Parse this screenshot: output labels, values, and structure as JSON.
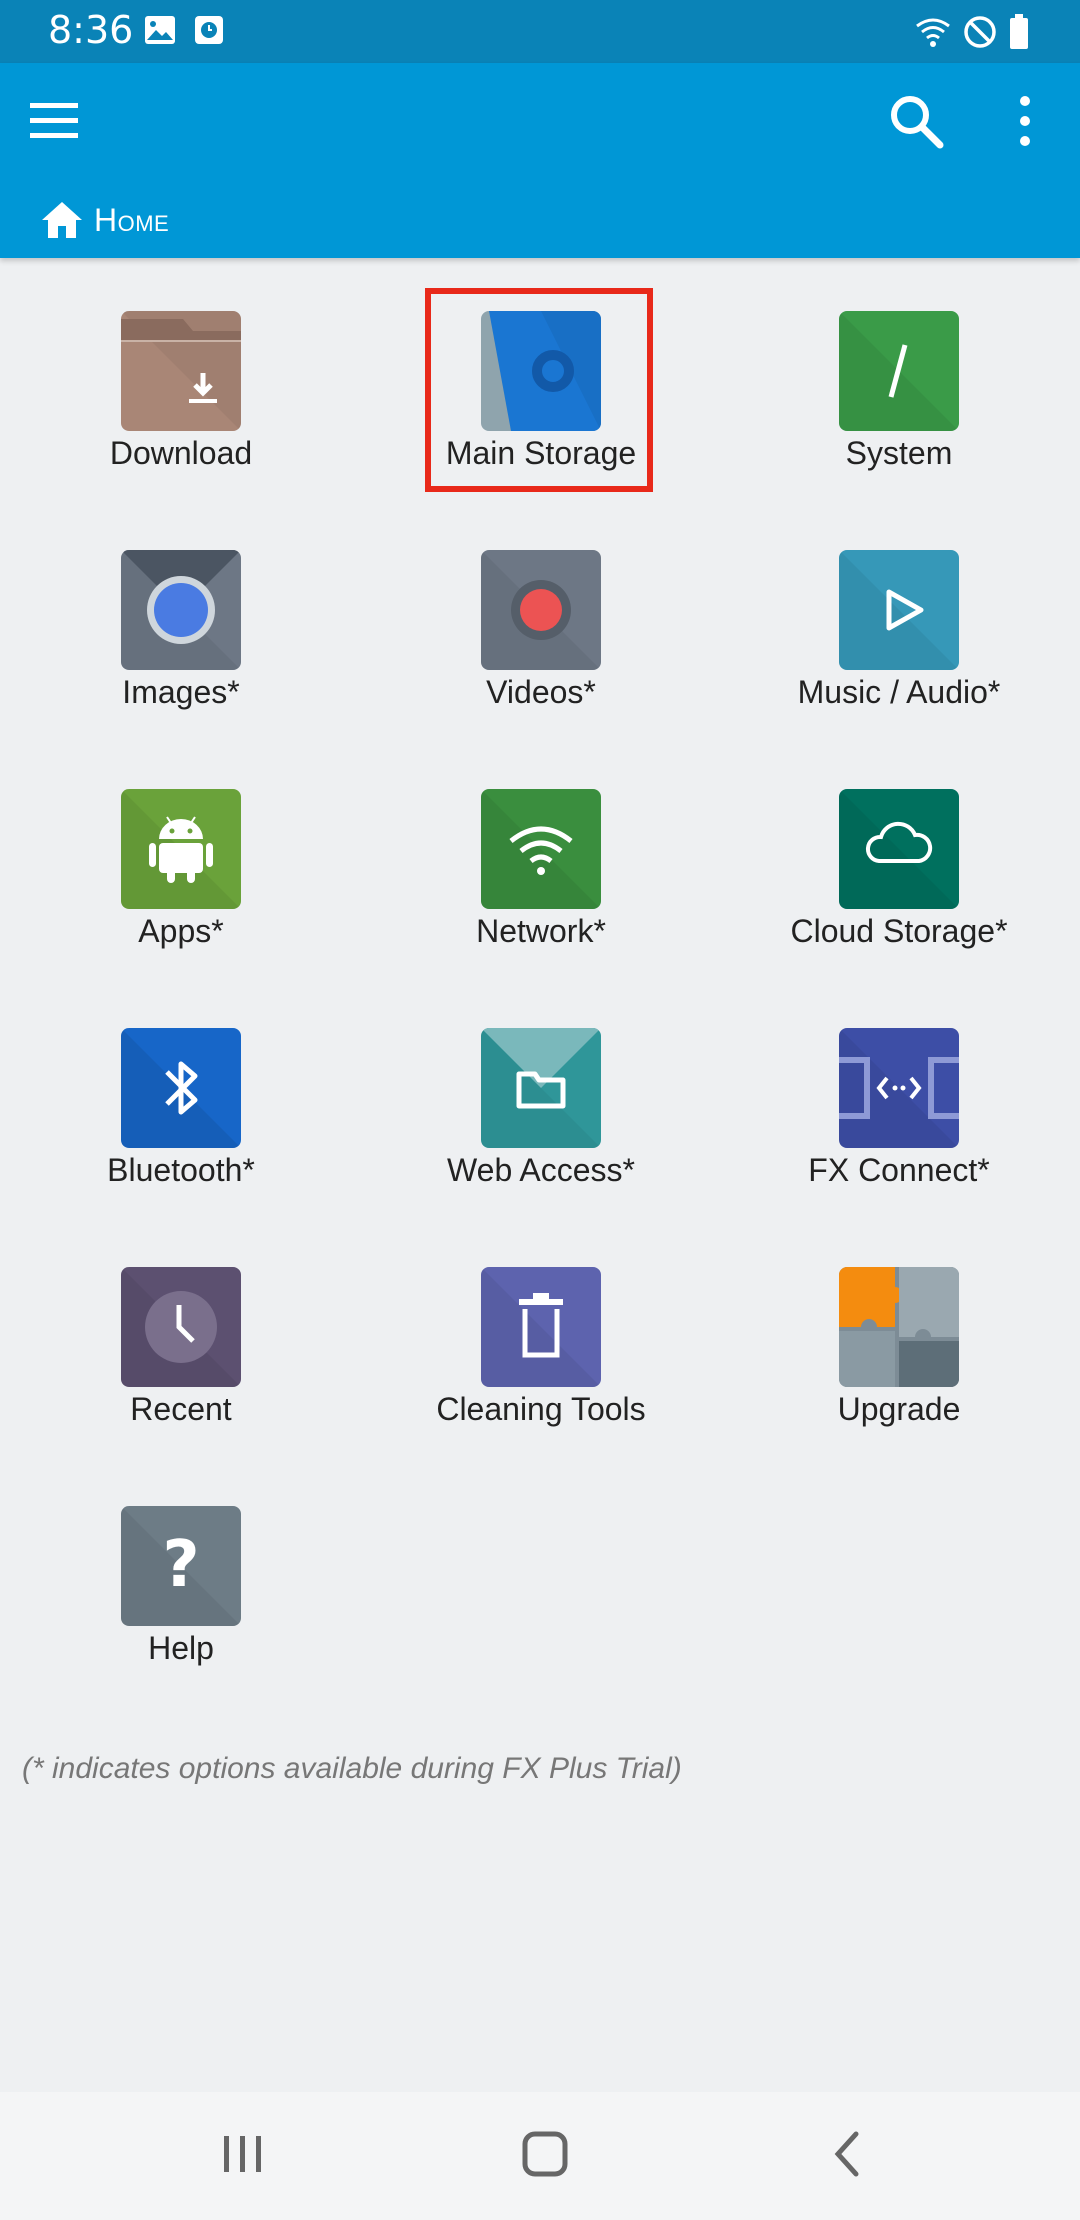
{
  "status_bar": {
    "time": "8:36",
    "left_icons": [
      "image-icon",
      "clock-app-icon"
    ],
    "right_icons": [
      "wifi-icon",
      "do-not-disturb-icon",
      "battery-icon"
    ]
  },
  "app_bar": {
    "menu_icon": "menu-icon",
    "search_icon": "search-icon",
    "more_icon": "more-vert-icon",
    "breadcrumb": {
      "icon": "home-icon",
      "label": "Home"
    }
  },
  "grid": {
    "items": [
      {
        "label": "Download",
        "icon": "download-folder-icon",
        "color": "#a98676"
      },
      {
        "label": "Main Storage",
        "icon": "main-storage-icon",
        "color": "#1a76d2"
      },
      {
        "label": "System",
        "icon": "system-icon",
        "color": "#3a9b48"
      },
      {
        "label": "Images*",
        "icon": "images-icon",
        "color": "#5f6f7e"
      },
      {
        "label": "Videos*",
        "icon": "videos-icon",
        "color": "#6d7785"
      },
      {
        "label": "Music / Audio*",
        "icon": "music-play-icon",
        "color": "#2f93b4"
      },
      {
        "label": "Apps*",
        "icon": "android-icon",
        "color": "#6aa23a"
      },
      {
        "label": "Network*",
        "icon": "wifi-network-icon",
        "color": "#3a8e3e"
      },
      {
        "label": "Cloud Storage*",
        "icon": "cloud-icon",
        "color": "#00705e"
      },
      {
        "label": "Bluetooth*",
        "icon": "bluetooth-icon",
        "color": "#1766c8"
      },
      {
        "label": "Web Access*",
        "icon": "folder-icon",
        "color": "#2f9699"
      },
      {
        "label": "FX Connect*",
        "icon": "fx-connect-icon",
        "color": "#3d4ea6"
      },
      {
        "label": "Recent",
        "icon": "clock-icon",
        "color": "#5c5070"
      },
      {
        "label": "Cleaning Tools",
        "icon": "trash-icon",
        "color": "#5d63ae"
      },
      {
        "label": "Upgrade",
        "icon": "puzzle-icon",
        "color": "#7d8c96"
      },
      {
        "label": "Help",
        "icon": "help-icon",
        "color": "#6d7c86"
      }
    ]
  },
  "selected_item": "Main Storage",
  "footnote": "(* indicates options available during FX Plus Trial)",
  "nav_bar": {
    "recents_icon": "recents-icon",
    "home_icon": "home-button-icon",
    "back_icon": "back-icon"
  }
}
